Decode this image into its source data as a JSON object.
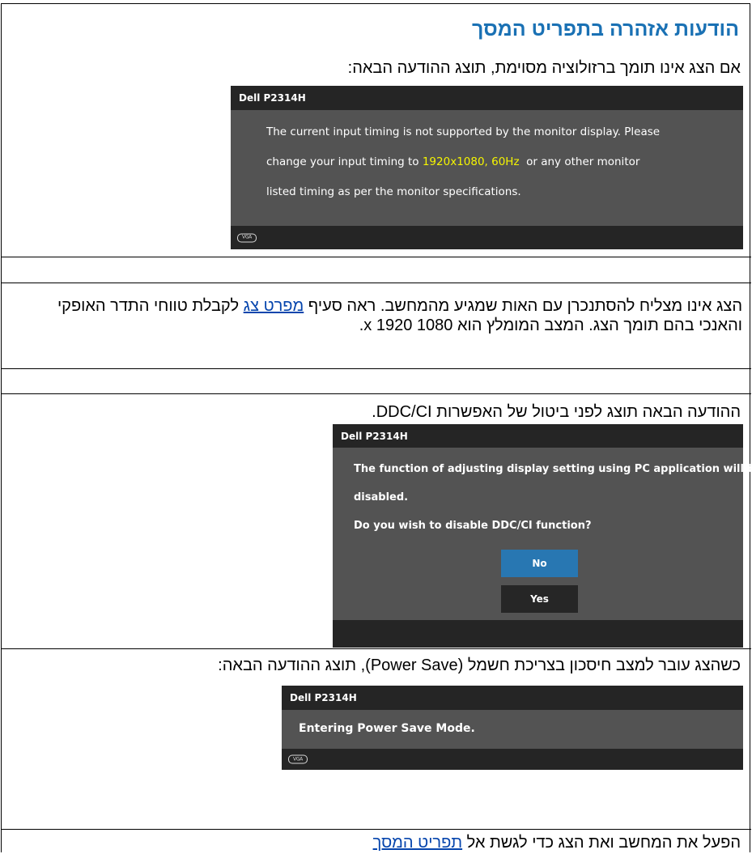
{
  "section_title": "הודעות אזהרה בתפריט המסך",
  "sections": {
    "unsupported": {
      "intro": "אם הצג אינו תומך ברזולוציה מסוימת, תוצג ההודעה הבאה:",
      "osd": {
        "model": "Dell P2314H",
        "line1": "The current input timing is not supported by the monitor display. Please",
        "line2_pre": "change your input timing to ",
        "line2_highlight": "1920x1080, 60Hz",
        "line2_post": "  or any other monitor",
        "line3": "listed timing as per the monitor specifications.",
        "logo_text": "VGA"
      }
    },
    "sync": {
      "text_pre": "הצג אינו מצליח להסתנכרן עם האות שמגיע מהמחשב. ראה סעיף ",
      "link": "מפרט צג",
      "text_post": " לקבלת טווחי התדר האופקי והאנכי בהם תומך הצג. המצב המומלץ הוא 1080 x 1920."
    },
    "ddc": {
      "intro": "ההודעה הבאה תוצג לפני ביטול של האפשרות DDC/CI.",
      "osd": {
        "model": "Dell P2314H",
        "line1": "The function of adjusting display setting using PC application will be",
        "line2": "disabled.",
        "line3": "Do you wish to disable DDC/CI function?",
        "btn_no": "No",
        "btn_yes": "Yes"
      },
      "colors": {
        "no_button": "#2877b2",
        "yes_button": "#262626"
      }
    },
    "power_save": {
      "intro": "כשהצג עובר למצב חיסכון בצריכת חשמל (Power Save), תוצג ההודעה הבאה:",
      "osd": {
        "model": "Dell P2314H",
        "message": "Entering Power Save Mode.",
        "logo_text": "VGA"
      }
    },
    "wake": {
      "text_pre": "הפעל את המחשב ואת הצג כדי לגשת אל ",
      "link": "תפריט המסך"
    }
  },
  "colors": {
    "title": "#1a71b4",
    "osd_header": "#252525",
    "osd_body": "#535353",
    "highlight": "#f5f500"
  }
}
